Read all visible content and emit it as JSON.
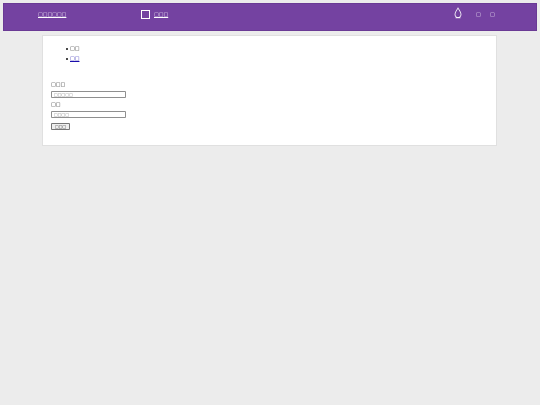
{
  "header": {
    "brand": "□□□□□□",
    "box_label": "□□□",
    "links": [
      "□",
      "□"
    ]
  },
  "tabs": [
    "□□",
    "□□"
  ],
  "form": {
    "fields": [
      {
        "label": "□□□",
        "placeholder": "□□□□□"
      },
      {
        "label": "□□",
        "placeholder": "□□□□"
      }
    ],
    "submit_label": "□□□"
  },
  "colors": {
    "header_bg": "#7442a1",
    "page_bg": "#ececec"
  },
  "icons": {
    "header_icon": "drop-icon",
    "box_icon": "square-icon"
  }
}
